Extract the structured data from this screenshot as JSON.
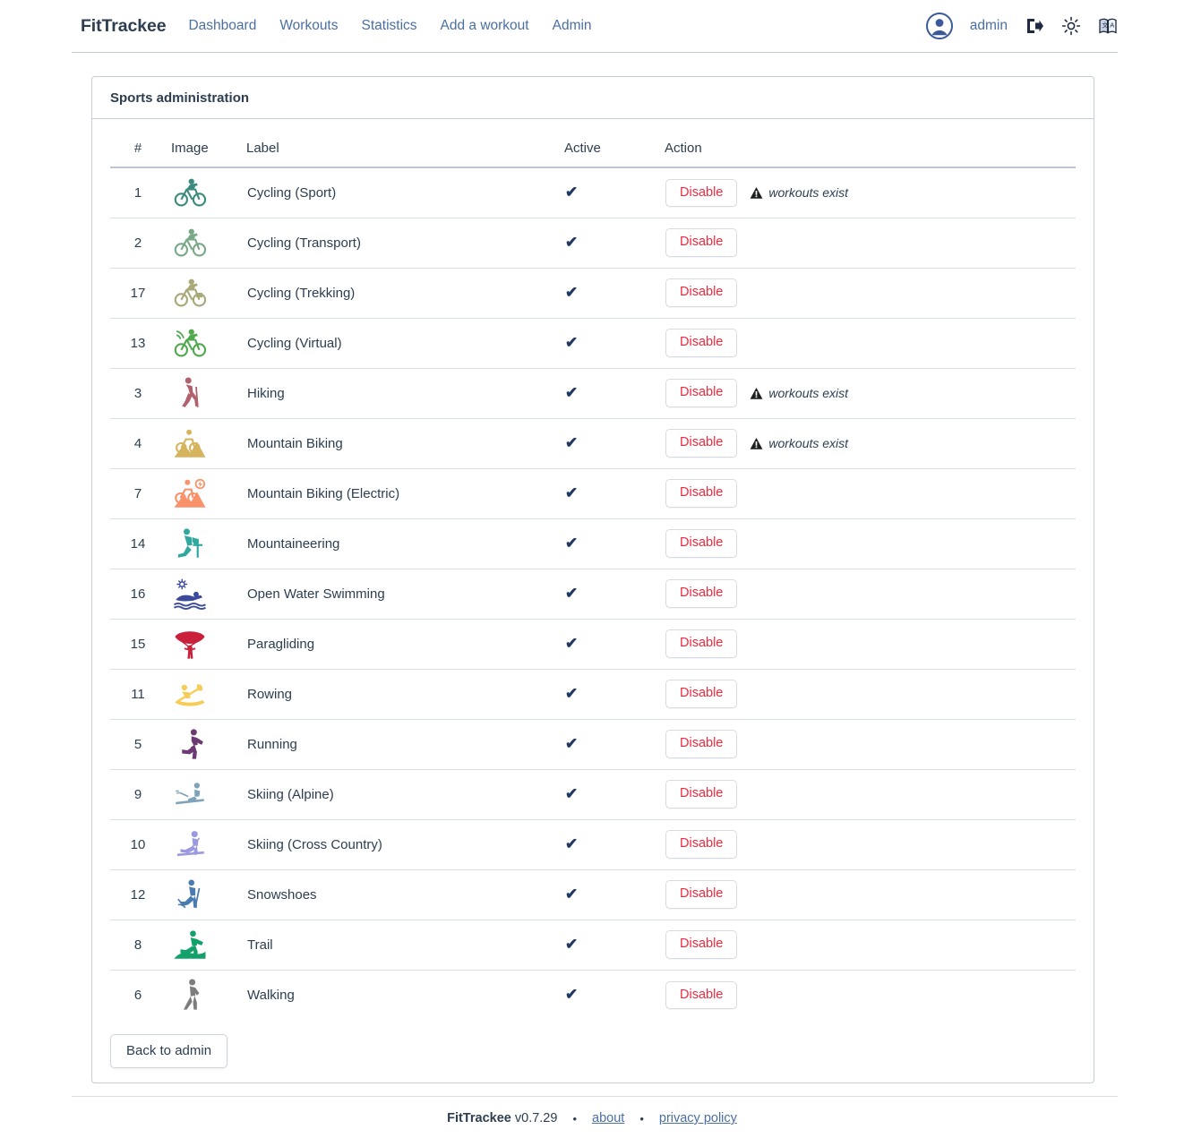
{
  "nav": {
    "brand": "FitTrackee",
    "links": [
      {
        "label": "Dashboard"
      },
      {
        "label": "Workouts"
      },
      {
        "label": "Statistics"
      },
      {
        "label": "Add a workout"
      },
      {
        "label": "Admin"
      }
    ],
    "user": "admin",
    "icons": {
      "avatar": "user-avatar-icon",
      "logout": "logout-icon",
      "theme": "sun-theme-icon",
      "language": "language-icon"
    }
  },
  "card": {
    "title": "Sports administration",
    "columns": [
      "#",
      "Image",
      "Label",
      "Active",
      "Action"
    ],
    "back_button": "Back to admin",
    "disable_label": "Disable",
    "warning_label": "workouts exist",
    "active_mark": "✔"
  },
  "sports": [
    {
      "id": "1",
      "label": "Cycling (Sport)",
      "icon": "cycling-sport-icon",
      "color": "#3a8a7d",
      "active": true,
      "warning": true
    },
    {
      "id": "2",
      "label": "Cycling (Transport)",
      "icon": "cycling-transport-icon",
      "color": "#79a887",
      "active": true,
      "warning": false
    },
    {
      "id": "17",
      "label": "Cycling (Trekking)",
      "icon": "cycling-trekking-icon",
      "color": "#a9a878",
      "active": true,
      "warning": false
    },
    {
      "id": "13",
      "label": "Cycling (Virtual)",
      "icon": "cycling-virtual-icon",
      "color": "#4fa94f",
      "active": true,
      "warning": false
    },
    {
      "id": "3",
      "label": "Hiking",
      "icon": "hiking-icon",
      "color": "#b3606e",
      "active": true,
      "warning": true
    },
    {
      "id": "4",
      "label": "Mountain Biking",
      "icon": "mountain-biking-icon",
      "color": "#d6b45e",
      "active": true,
      "warning": true
    },
    {
      "id": "7",
      "label": "Mountain Biking (Electric)",
      "icon": "mountain-biking-electric-icon",
      "color": "#f9926a",
      "active": true,
      "warning": false
    },
    {
      "id": "14",
      "label": "Mountaineering",
      "icon": "mountaineering-icon",
      "color": "#2fa8a0",
      "active": true,
      "warning": false
    },
    {
      "id": "16",
      "label": "Open Water Swimming",
      "icon": "open-water-swimming-icon",
      "color": "#3b4a9c",
      "active": true,
      "warning": false
    },
    {
      "id": "15",
      "label": "Paragliding",
      "icon": "paragliding-icon",
      "color": "#c9203c",
      "active": true,
      "warning": false
    },
    {
      "id": "11",
      "label": "Rowing",
      "icon": "rowing-icon",
      "color": "#f7cc56",
      "active": true,
      "warning": false
    },
    {
      "id": "5",
      "label": "Running",
      "icon": "running-icon",
      "color": "#6c3a72",
      "active": true,
      "warning": false
    },
    {
      "id": "9",
      "label": "Skiing (Alpine)",
      "icon": "skiing-alpine-icon",
      "color": "#7fa3bb",
      "active": true,
      "warning": false
    },
    {
      "id": "10",
      "label": "Skiing (Cross Country)",
      "icon": "skiing-cross-country-icon",
      "color": "#9b9ae0",
      "active": true,
      "warning": false
    },
    {
      "id": "12",
      "label": "Snowshoes",
      "icon": "snowshoes-icon",
      "color": "#4a7bb0",
      "active": true,
      "warning": false
    },
    {
      "id": "8",
      "label": "Trail",
      "icon": "trail-icon",
      "color": "#13a06a",
      "active": true,
      "warning": false
    },
    {
      "id": "6",
      "label": "Walking",
      "icon": "walking-icon",
      "color": "#7d7d7d",
      "active": true,
      "warning": false
    }
  ],
  "footer": {
    "brand": "FitTrackee",
    "version": "v0.7.29",
    "dot": "•",
    "about": "about",
    "privacy": "privacy policy"
  },
  "colors": {
    "nav_link": "#4a6fa5",
    "text": "#2c3e50",
    "danger": "#f0293e",
    "border": "#c6ccd8"
  }
}
